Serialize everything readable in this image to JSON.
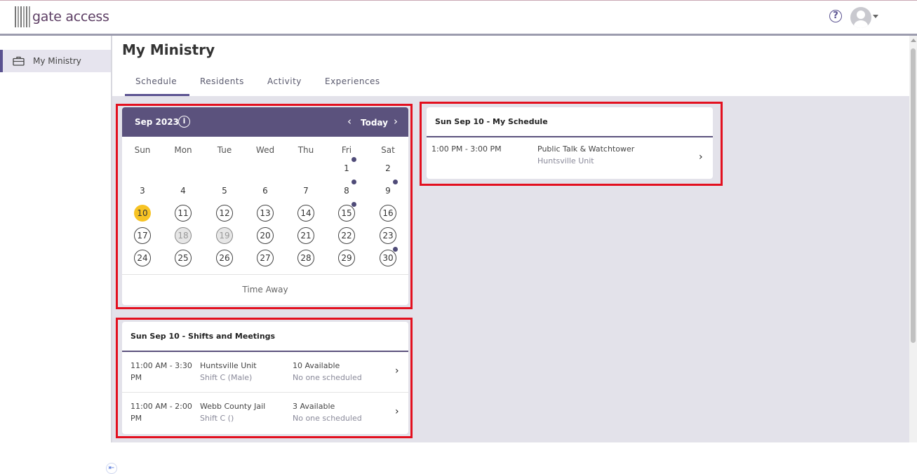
{
  "app": {
    "logo_text": "gate access"
  },
  "header": {
    "help_icon": "question-circle-icon",
    "avatar_icon": "user-avatar-icon"
  },
  "sidebar": {
    "items": [
      {
        "label": "My Ministry",
        "icon": "briefcase-icon"
      }
    ]
  },
  "page": {
    "title": "My Ministry"
  },
  "tabs": [
    {
      "label": "Schedule",
      "active": true
    },
    {
      "label": "Residents"
    },
    {
      "label": "Activity"
    },
    {
      "label": "Experiences"
    }
  ],
  "calendar": {
    "month_label": "Sep 2023",
    "today_label": "Today",
    "weekdays": [
      "Sun",
      "Mon",
      "Tue",
      "Wed",
      "Thu",
      "Fri",
      "Sat"
    ],
    "days": [
      "1",
      "2",
      "3",
      "4",
      "5",
      "6",
      "7",
      "8",
      "9",
      "10",
      "11",
      "12",
      "13",
      "14",
      "15",
      "16",
      "17",
      "18",
      "19",
      "20",
      "21",
      "22",
      "23",
      "24",
      "25",
      "26",
      "27",
      "28",
      "29",
      "30"
    ],
    "selected_day": "10",
    "event_days": [
      "1",
      "8",
      "9",
      "15",
      "30"
    ],
    "time_away_label": "Time Away"
  },
  "my_schedule": {
    "title": "Sun Sep 10 - My Schedule",
    "items": [
      {
        "time": "1:00 PM - 3:00 PM",
        "name": "Public Talk & Watchtower",
        "location": "Huntsville Unit"
      }
    ]
  },
  "shifts": {
    "title": "Sun Sep 10 - Shifts and Meetings",
    "items": [
      {
        "time_line1": "11:00 AM - 3:30",
        "time_line2": "PM",
        "location": "Huntsville Unit",
        "shift": "Shift C (Male)",
        "available": "10 Available",
        "scheduled": "No one scheduled"
      },
      {
        "time_line1": "11:00 AM - 2:00",
        "time_line2": "PM",
        "location": "Webb County Jail",
        "shift": "Shift C ()",
        "available": "3 Available",
        "scheduled": "No one scheduled"
      }
    ]
  },
  "colors": {
    "accent": "#5b527d",
    "selected_day": "#f7c324",
    "highlight_box": "#e3101f"
  }
}
